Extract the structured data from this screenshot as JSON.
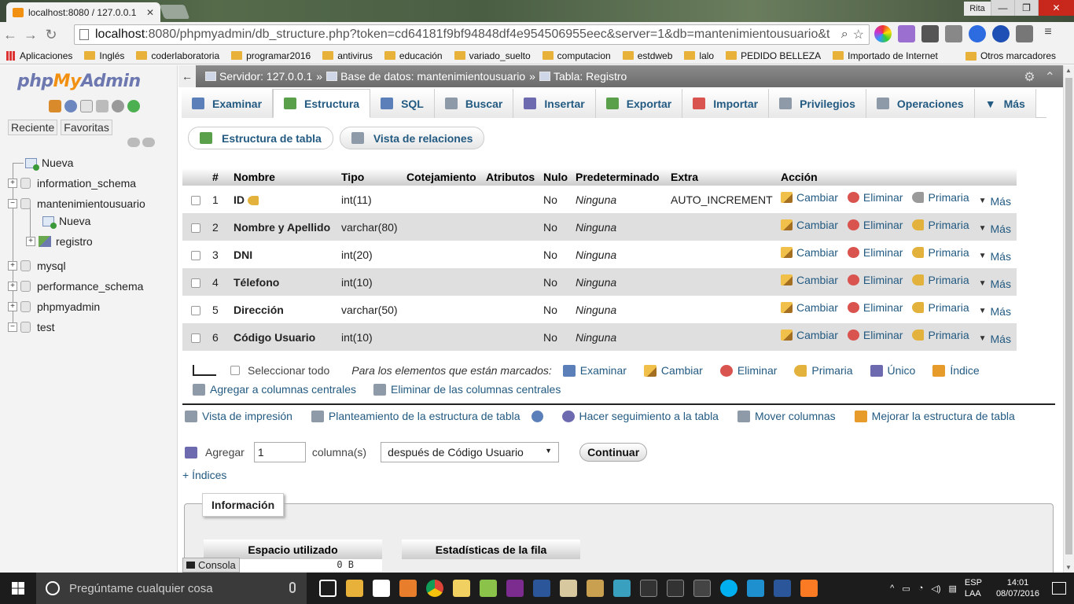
{
  "browser": {
    "tab_title": "localhost:8080 / 127.0.0.1",
    "tab_close": "✕",
    "user": "Rita",
    "url_host": "localhost",
    "url_rest": ":8080/phpmyadmin/db_structure.php?token=cd64181f9bf94848df4e954506955eec&server=1&db=mantenimientousuario&t",
    "bookmarks": [
      "Aplicaciones",
      "Inglés",
      "coderlaboratoria",
      "programar2016",
      "antivirus",
      "educación",
      "variado_suelto",
      "computacion",
      "estdweb",
      "lalo",
      "PEDIDO BELLEZA",
      "Importado de Internet"
    ],
    "other_bookmarks": "Otros marcadores"
  },
  "nav": {
    "logo_php": "php",
    "logo_my": "My",
    "logo_admin": "Admin",
    "recent": "Reciente",
    "favorites": "Favoritas",
    "tree": {
      "new": "Nueva",
      "db1": "information_schema",
      "db2": "mantenimientousuario",
      "db2_new": "Nueva",
      "db2_table": "registro",
      "db3": "mysql",
      "db4": "performance_schema",
      "db5": "phpmyadmin",
      "db6": "test"
    }
  },
  "breadcrumb": {
    "server": "Servidor: 127.0.0.1",
    "database": "Base de datos: mantenimientousuario",
    "table": "Tabla: Registro",
    "sep": "»"
  },
  "tabs": [
    "Examinar",
    "Estructura",
    "SQL",
    "Buscar",
    "Insertar",
    "Exportar",
    "Importar",
    "Privilegios",
    "Operaciones",
    "Más"
  ],
  "subtabs": {
    "structure": "Estructura de tabla",
    "relations": "Vista de relaciones"
  },
  "table": {
    "headers": [
      "#",
      "Nombre",
      "Tipo",
      "Cotejamiento",
      "Atributos",
      "Nulo",
      "Predeterminado",
      "Extra",
      "Acción"
    ],
    "rows": [
      {
        "n": "1",
        "name": "ID",
        "type": "int(11)",
        "null": "No",
        "default": "Ninguna",
        "extra": "AUTO_INCREMENT"
      },
      {
        "n": "2",
        "name": "Nombre y Apellido",
        "type": "varchar(80)",
        "null": "No",
        "default": "Ninguna",
        "extra": ""
      },
      {
        "n": "3",
        "name": "DNI",
        "type": "int(20)",
        "null": "No",
        "default": "Ninguna",
        "extra": ""
      },
      {
        "n": "4",
        "name": "Télefono",
        "type": "int(10)",
        "null": "No",
        "default": "Ninguna",
        "extra": ""
      },
      {
        "n": "5",
        "name": "Dirección",
        "type": "varchar(50)",
        "null": "No",
        "default": "Ninguna",
        "extra": ""
      },
      {
        "n": "6",
        "name": "Código Usuario",
        "type": "int(10)",
        "null": "No",
        "default": "Ninguna",
        "extra": ""
      }
    ],
    "actions": {
      "change": "Cambiar",
      "drop": "Eliminar",
      "primary": "Primaria",
      "more": "Más"
    }
  },
  "bulk": {
    "select_all": "Seleccionar todo",
    "with_selected": "Para los elementos que están marcados:",
    "browse": "Examinar",
    "change": "Cambiar",
    "drop": "Eliminar",
    "primary": "Primaria",
    "unique": "Único",
    "index": "Índice",
    "add_central": "Agregar a columnas centrales",
    "remove_central": "Eliminar de las columnas centrales"
  },
  "links": {
    "print": "Vista de impresión",
    "propose": "Planteamiento de la estructura de tabla",
    "track": "Hacer seguimiento a la tabla",
    "move": "Mover columnas",
    "improve": "Mejorar la estructura de tabla"
  },
  "add": {
    "label": "Agregar",
    "count": "1",
    "columns": "columna(s)",
    "position": "después de Código Usuario",
    "go": "Continuar"
  },
  "indices": "+ Índices",
  "info": {
    "legend": "Información",
    "space": "Espacio utilizado",
    "row_stats": "Estadísticas de la fila",
    "space_value": "0 B"
  },
  "console": "Consola",
  "taskbar": {
    "search": "Pregúntame cualquier cosa",
    "lang1": "ESP",
    "lang2": "LAA",
    "time": "14:01",
    "date": "08/07/2016"
  }
}
